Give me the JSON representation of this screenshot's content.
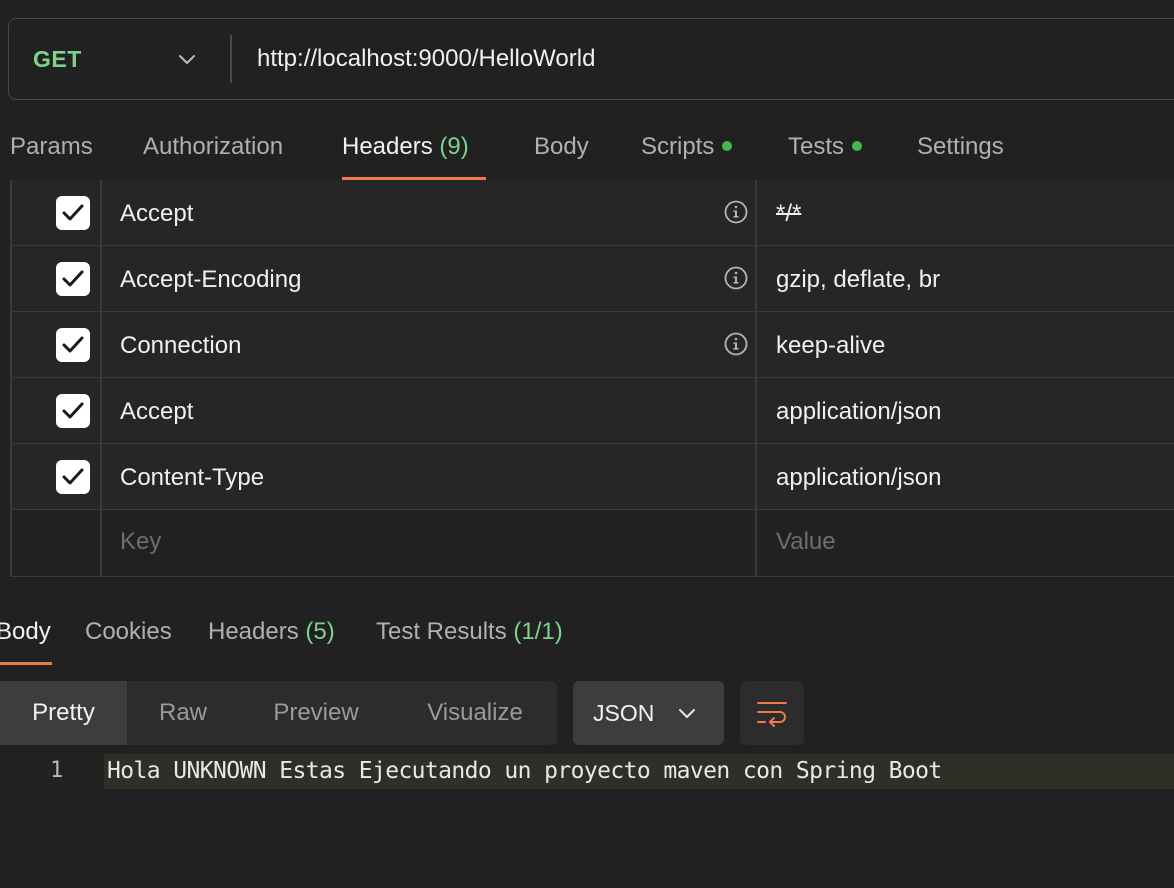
{
  "request": {
    "method": "GET",
    "url": "http://localhost:9000/HelloWorld"
  },
  "request_tabs": [
    {
      "label": "Params"
    },
    {
      "label": "Authorization"
    },
    {
      "label": "Headers",
      "count": "(9)",
      "active": true
    },
    {
      "label": "Body"
    },
    {
      "label": "Scripts",
      "indicator": "green-dot"
    },
    {
      "label": "Tests",
      "indicator": "green-dot"
    },
    {
      "label": "Settings"
    }
  ],
  "headers": [
    {
      "checked": true,
      "key": "Accept",
      "value": "*/*",
      "info_icon": true
    },
    {
      "checked": true,
      "key": "Accept-Encoding",
      "value": "gzip, deflate, br",
      "info_icon": true
    },
    {
      "checked": true,
      "key": "Connection",
      "value": "keep-alive",
      "info_icon": true
    },
    {
      "checked": true,
      "key": "Accept",
      "value": "application/json",
      "info_icon": false
    },
    {
      "checked": true,
      "key": "Content-Type",
      "value": "application/json",
      "info_icon": false
    }
  ],
  "headers_placeholder": {
    "key": "Key",
    "value": "Value"
  },
  "response_tabs": [
    {
      "label": "Body",
      "active": true
    },
    {
      "label": "Cookies"
    },
    {
      "label": "Headers",
      "count": "(5)"
    },
    {
      "label": "Test Results",
      "count": "(1/1)"
    }
  ],
  "view_modes": [
    {
      "label": "Pretty",
      "active": true
    },
    {
      "label": "Raw"
    },
    {
      "label": "Preview"
    },
    {
      "label": "Visualize"
    }
  ],
  "format": {
    "selected": "JSON",
    "icon": "chevron-down-icon"
  },
  "wrap_icon": "wrap-lines-icon",
  "response_body": {
    "lines": [
      {
        "number": "1",
        "text": "Hola UNKNOWN Estas Ejecutando un proyecto maven con Spring Boot"
      }
    ]
  },
  "colors": {
    "background": "#212121",
    "accent_orange": "#ef7b4b",
    "accent_green": "#7fd28a",
    "dot_green": "#3fb950"
  }
}
